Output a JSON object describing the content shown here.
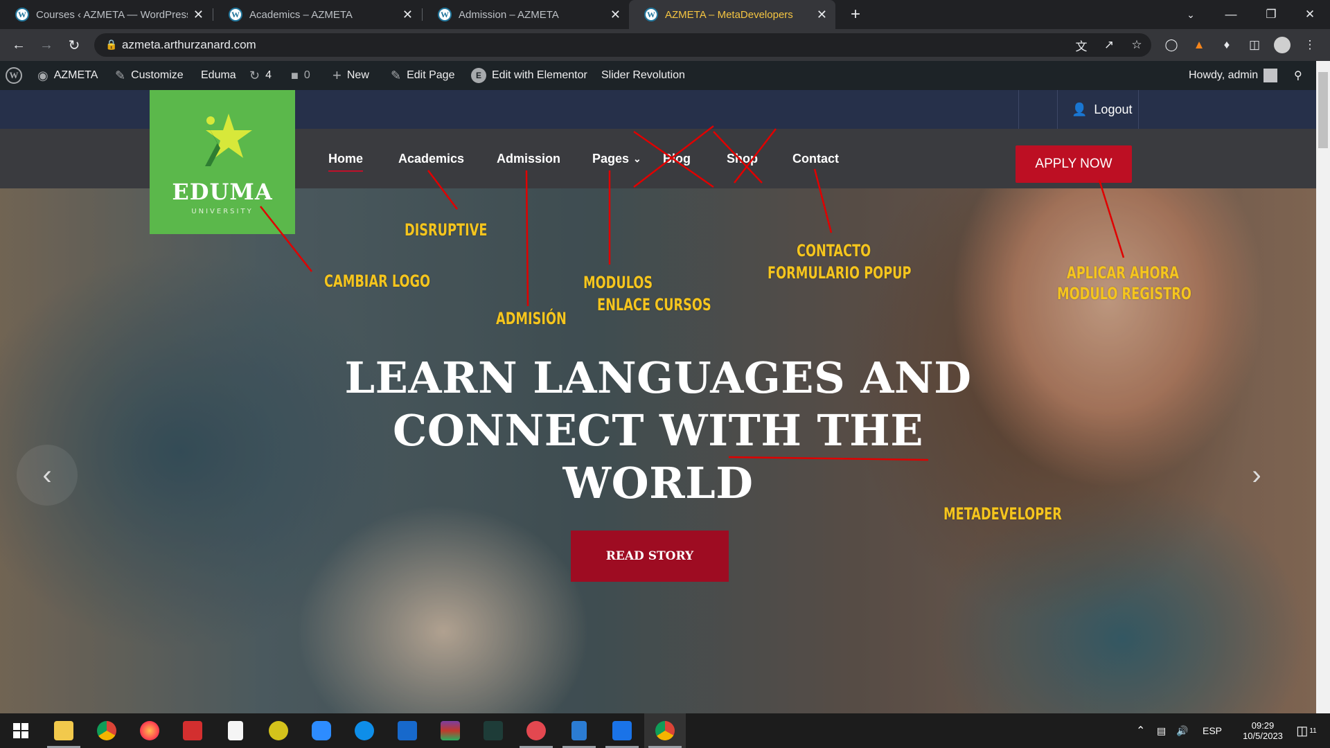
{
  "browser": {
    "tabs": [
      {
        "title": "Courses ‹ AZMETA — WordPress",
        "active": false
      },
      {
        "title": "Academics – AZMETA",
        "active": false
      },
      {
        "title": "Admission – AZMETA",
        "active": false
      },
      {
        "title": "AZMETA – MetaDevelopers",
        "active": true
      }
    ],
    "new_tab": "+",
    "close": "✕",
    "url": "azmeta.arthurzanard.com"
  },
  "wp_admin_bar": {
    "site_name": "AZMETA",
    "customize": "Customize",
    "theme": "Eduma",
    "updates": "4",
    "comments": "0",
    "new": "New",
    "edit_page": "Edit Page",
    "elementor": "Edit with Elementor",
    "slider": "Slider Revolution",
    "howdy": "Howdy, admin"
  },
  "site": {
    "logo_text": "EDUMA",
    "logo_sub": "UNIVERSITY",
    "logout": "Logout",
    "menu": [
      "Home",
      "Academics",
      "Admission",
      "Pages",
      "Blog",
      "Shop",
      "Contact"
    ],
    "apply": "APPLY NOW",
    "headline": "LEARN LANGUAGES AND CONNECT WITH THE WORLD",
    "read_story": "READ STORY"
  },
  "annotations": {
    "disruptive": "DISRUPTIVE",
    "cambiar_logo": "CAMBIAR LOGO",
    "admision": "ADMISIÓN",
    "modulos": "MODULOS",
    "enlace": "ENLACE CURSOS",
    "contacto": "CONTACTO",
    "formulario": "FORMULARIO POPUP",
    "aplicar": "APLICAR AHORA",
    "modulo_registro": "MODULO REGISTRO",
    "metadeveloper": "METADEVELOPER"
  },
  "taskbar": {
    "lang": "ESP",
    "time": "09:29",
    "date": "10/5/2023",
    "notifications": "11"
  },
  "colors": {
    "accent_red": "#bd0f23",
    "logo_green": "#5bb84b",
    "annotation_yellow": "#f5c51e",
    "annotation_line": "#e00000"
  }
}
